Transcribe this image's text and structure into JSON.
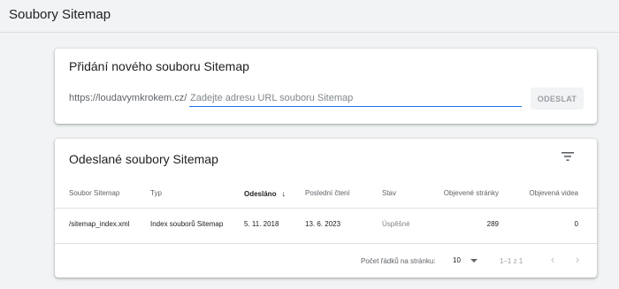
{
  "header": {
    "title": "Soubory Sitemap"
  },
  "add_sitemap": {
    "title": "Přidání nového souboru Sitemap",
    "url_prefix": "https://loudavymkrokem.cz/",
    "input_placeholder": "Zadejte adresu URL souboru Sitemap",
    "input_value": "",
    "submit_label": "ODESLAT"
  },
  "submitted": {
    "title": "Odeslané soubory Sitemap",
    "filter_icon": "filter-icon",
    "columns": {
      "sitemap": "Soubor Sitemap",
      "type": "Typ",
      "submitted": "Odesláno",
      "last_read": "Poslední čtení",
      "status": "Stav",
      "pages": "Objevené stránky",
      "videos": "Objevená videa"
    },
    "sort_icon": "arrow-down-icon",
    "rows": [
      {
        "sitemap": "/sitemap_index.xml",
        "type": "Index souborů Sitemap",
        "submitted": "5. 11. 2018",
        "last_read": "13. 6. 2023",
        "status": "Úspěšné",
        "pages": "289",
        "videos": "0"
      }
    ],
    "pagination": {
      "rows_per_page_label": "Počet řádků na stránku:",
      "rows_per_page": "10",
      "range": "1–1 z 1"
    }
  },
  "colors": {
    "accent": "#1a73e8",
    "background": "#f1f3f4",
    "status_text": "#80868b"
  }
}
